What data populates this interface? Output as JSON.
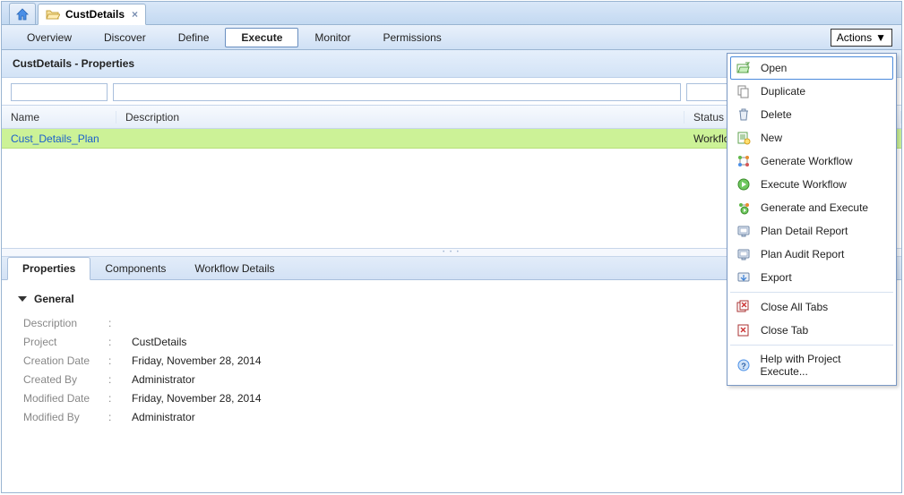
{
  "colors": {
    "accent": "#1a5fcc",
    "row_highlight": "#ccf297"
  },
  "top_tab": {
    "home_name": "home",
    "main_label": "CustDetails"
  },
  "nav": {
    "items": [
      {
        "label": "Overview",
        "active": false
      },
      {
        "label": "Discover",
        "active": false
      },
      {
        "label": "Define",
        "active": false
      },
      {
        "label": "Execute",
        "active": true
      },
      {
        "label": "Monitor",
        "active": false
      },
      {
        "label": "Permissions",
        "active": false
      }
    ],
    "actions_label": "Actions"
  },
  "panel_title": "CustDetails - Properties",
  "filters": {
    "name": "",
    "description": "",
    "status": ""
  },
  "table": {
    "headers": {
      "name": "Name",
      "description": "Description",
      "status": "Status"
    },
    "rows": [
      {
        "name": "Cust_Details_Plan",
        "description": "",
        "status": "Workflow Generated"
      }
    ]
  },
  "detail_tabs": [
    {
      "label": "Properties",
      "active": true
    },
    {
      "label": "Components",
      "active": false
    },
    {
      "label": "Workflow Details",
      "active": false
    }
  ],
  "general": {
    "section_title": "General",
    "rows": [
      {
        "label": "Description",
        "value": ""
      },
      {
        "label": "Project",
        "value": "CustDetails"
      },
      {
        "label": "Creation Date",
        "value": "Friday, November 28, 2014"
      },
      {
        "label": "Created By",
        "value": "Administrator"
      },
      {
        "label": "Modified Date",
        "value": "Friday, November 28, 2014"
      },
      {
        "label": "Modified By",
        "value": "Administrator"
      }
    ]
  },
  "actions_menu": [
    {
      "label": "Open",
      "icon": "open-icon",
      "highlighted": true
    },
    {
      "label": "Duplicate",
      "icon": "duplicate-icon"
    },
    {
      "label": "Delete",
      "icon": "delete-icon"
    },
    {
      "label": "New",
      "icon": "new-icon"
    },
    {
      "label": "Generate Workflow",
      "icon": "generate-workflow-icon"
    },
    {
      "label": "Execute Workflow",
      "icon": "execute-workflow-icon"
    },
    {
      "label": "Generate and Execute",
      "icon": "generate-execute-icon"
    },
    {
      "label": "Plan Detail Report",
      "icon": "report-icon"
    },
    {
      "label": "Plan Audit Report",
      "icon": "report-icon"
    },
    {
      "label": "Export",
      "icon": "export-icon"
    },
    {
      "sep": true
    },
    {
      "label": "Close All Tabs",
      "icon": "close-all-tabs-icon"
    },
    {
      "label": "Close Tab",
      "icon": "close-tab-icon"
    },
    {
      "sep": true
    },
    {
      "label": "Help with Project Execute...",
      "icon": "help-icon"
    }
  ]
}
